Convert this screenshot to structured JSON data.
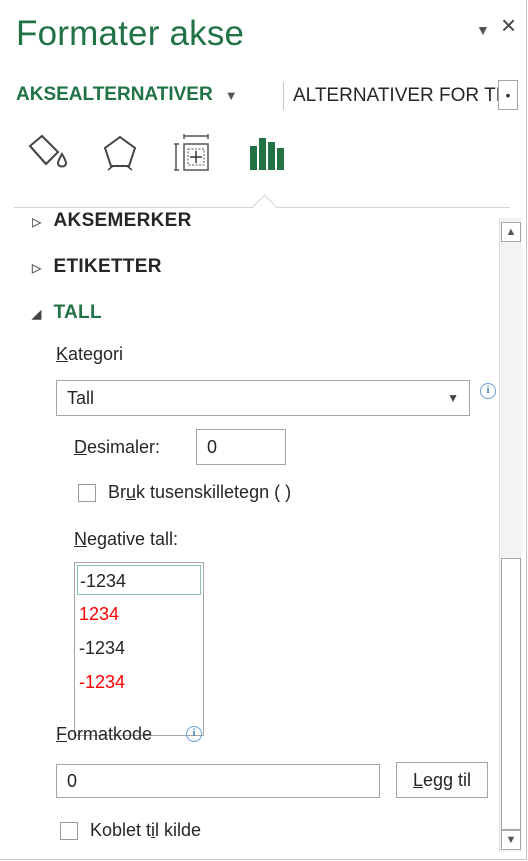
{
  "pane": {
    "title": "Formater akse",
    "menu_icon": "dropdown-triangle-icon",
    "close_icon": "close-icon"
  },
  "tabs": {
    "active": "AKSEALTERNATIVER",
    "inactive": "ALTERNATIVER FOR TEKST"
  },
  "icon_bar": [
    "fill-line-icon",
    "effects-pentagon-icon",
    "size-properties-icon",
    "axis-options-bar-chart-icon"
  ],
  "colors": {
    "accent": "#217346",
    "red": "#ff0000",
    "text": "#262626",
    "border": "#a6a6a6"
  },
  "sections": {
    "aksemerker": "AKSEMERKER",
    "etiketter": "ETIKETTER",
    "tall": "TALL"
  },
  "tall": {
    "kategori_label_k": "K",
    "kategori_label_rest": "ategori",
    "kategori_value": "Tall",
    "desimaler_label_d": "D",
    "desimaler_label_rest": "esimaler:",
    "desimaler_value": "0",
    "tusenskille_a": "Br",
    "tusenskille_u": "u",
    "tusenskille_b": "k tusenskilletegn ( )",
    "negative_label_n": "N",
    "negative_label_rest": "egative tall:",
    "negative_options": [
      {
        "text": "-1234",
        "color": "#262626",
        "selected": true
      },
      {
        "text": "1234",
        "color": "#ff0000",
        "selected": false
      },
      {
        "text": "-1234",
        "color": "#262626",
        "selected": false
      },
      {
        "text": "-1234",
        "color": "#ff0000",
        "selected": false
      }
    ],
    "formatkode_f": "F",
    "formatkode_rest": "ormatkode",
    "formatkode_value": "0",
    "legg_til_a": "L",
    "legg_til_b": "egg til",
    "koblet_a": "Koblet t",
    "koblet_u": "i",
    "koblet_b": "l kilde"
  }
}
